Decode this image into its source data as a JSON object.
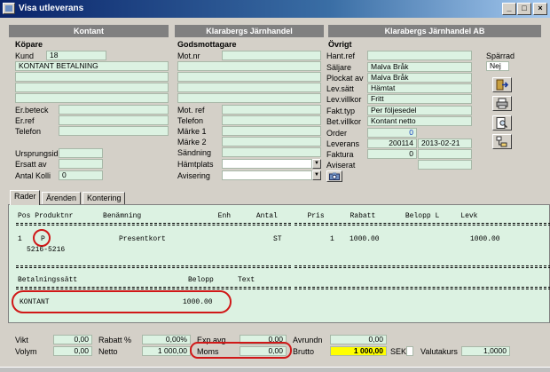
{
  "window": {
    "title": "Visa utleverans",
    "min": "_",
    "max": "□",
    "close": "×"
  },
  "headers": {
    "h1": "Kontant",
    "h2": "Klarabergs Järnhandel",
    "h3": "Klarabergs Järnhandel AB"
  },
  "kopare": {
    "title": "Köpare",
    "kund_label": "Kund",
    "kund": "18",
    "name": "KONTANT BETALNING",
    "erbeteck_label": "Er.beteck",
    "erref_label": "Er.ref",
    "telefon_label": "Telefon",
    "ursprungsid_label": "Ursprungsid",
    "ersatt_label": "Ersatt av",
    "kolli_label": "Antal Kolli",
    "kolli": "0"
  },
  "godsmottagare": {
    "title": "Godsmottagare",
    "motnr_label": "Mot.nr",
    "motref_label": "Mot. ref",
    "telefon_label": "Telefon",
    "marke1_label": "Märke 1",
    "marke2_label": "Märke 2",
    "sandning_label": "Sändning",
    "hamtplats_label": "Hämtplats",
    "avisering_label": "Avisering"
  },
  "ovrigt": {
    "title": "Övrigt",
    "hantref_label": "Hant.ref",
    "saljare_label": "Säljare",
    "saljare": "Malva Bråk",
    "plockat_label": "Plockat av",
    "plockat": "Malva Bråk",
    "levsatt_label": "Lev.sätt",
    "levsatt": "Hämtat",
    "levvillkor_label": "Lev.villkor",
    "levvillkor": "Fritt",
    "fakttyp_label": "Fakt.typ",
    "fakttyp": "Per följesedel",
    "betvillkor_label": "Bet.villkor",
    "betvillkor": "Kontant netto",
    "order_label": "Order",
    "order": "0",
    "leverans_label": "Leverans",
    "leverans_nr": "200114",
    "leverans_date": "2013-02-21",
    "faktura_label": "Faktura",
    "faktura": "0",
    "aviserat_label": "Aviserat",
    "sparrad_label": "Spärrad",
    "sparrad": "Nej"
  },
  "tabs": [
    "Rader",
    "Ärenden",
    "Kontering"
  ],
  "rows_header": "Pos Produktnr       Benämning                  Enh      Antal       Pris      Rabatt       Belopp L     Levk",
  "row": {
    "pos": "1",
    "produktnr": "P",
    "benamning": "Presentkort",
    "enh": "ST",
    "antal": "1",
    "pris": "1000.00",
    "belopp": "1000.00",
    "sub": "5216-5216"
  },
  "payment": {
    "header_method": "Betalningssätt",
    "header_amount": "Belopp",
    "header_text": "Text",
    "method": "KONTANT",
    "amount": "1000.00"
  },
  "totals": {
    "vikt_label": "Vikt",
    "vikt": "0,00",
    "volym_label": "Volym",
    "volym": "0,00",
    "rabatt_label": "Rabatt %",
    "rabatt": "0,00%",
    "netto_label": "Netto",
    "netto": "1 000,00",
    "expavg_label": "Exp.avg",
    "expavg": "0,00",
    "moms_label": "Moms",
    "moms": "0,00",
    "avrundn_label": "Avrundn",
    "avrundn": "0,00",
    "brutto_label": "Brutto",
    "brutto": "1 000,00",
    "currency": "SEK",
    "valutakurs_label": "Valutakurs",
    "valutakurs": "1,0000"
  },
  "colors": {
    "field_bg": "#dcf2e2",
    "highlight": "#ffff00",
    "annotation": "#d01818",
    "titlebar": "#0a246a"
  }
}
